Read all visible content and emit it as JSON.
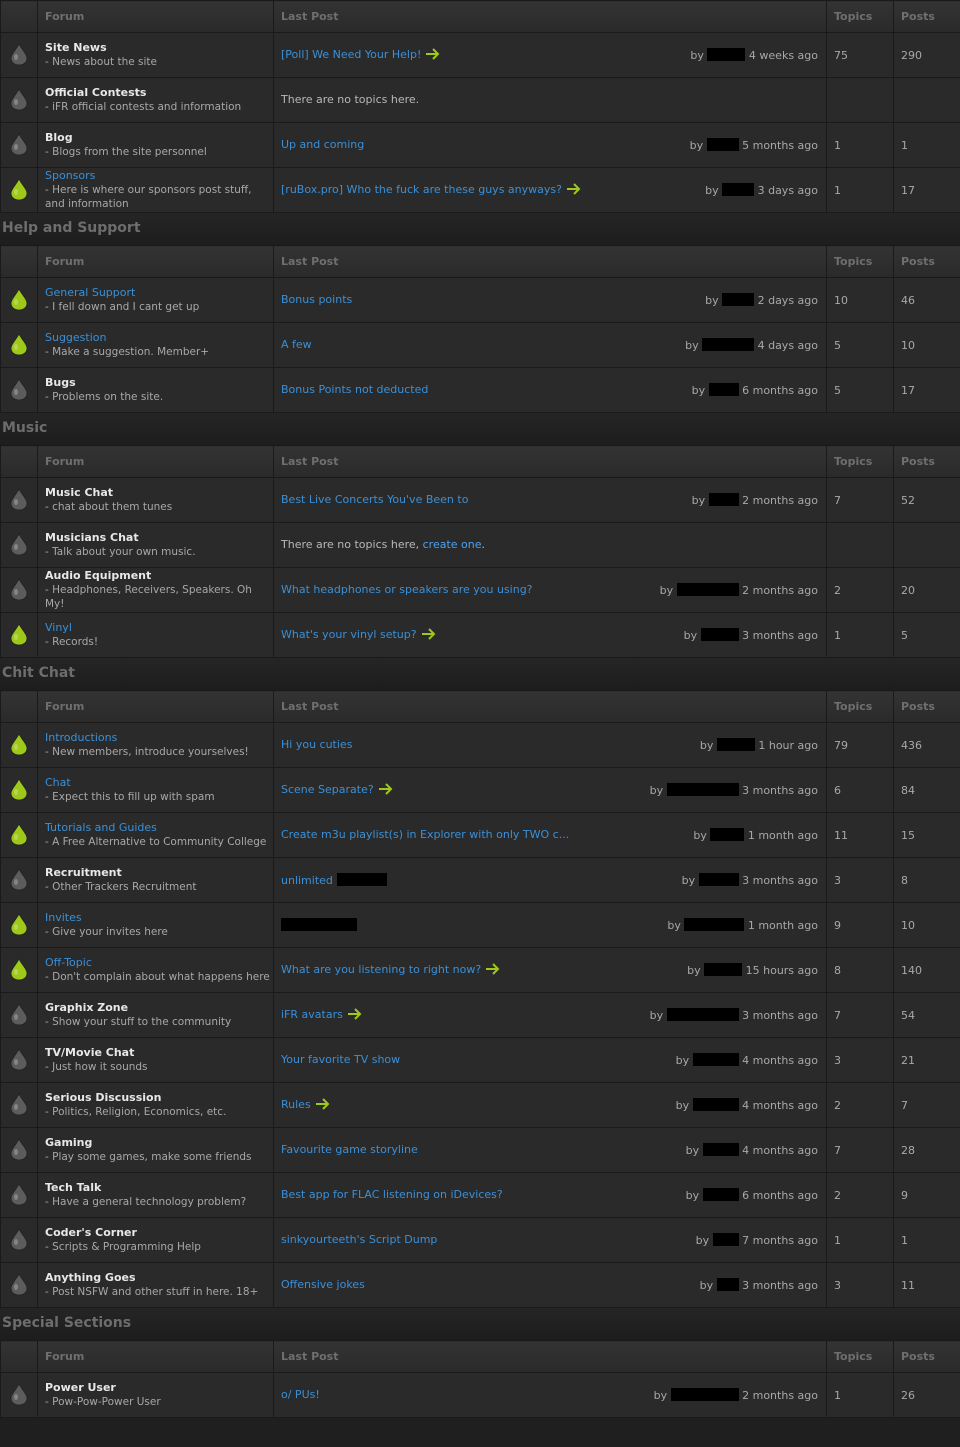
{
  "headers": {
    "forum": "Forum",
    "last_post": "Last Post",
    "topics": "Topics",
    "posts": "Posts"
  },
  "labels": {
    "by": "by",
    "no_topics": "There are no topics here.",
    "no_topics_create_prefix": "There are no topics here, ",
    "create_one": "create one",
    "period": "."
  },
  "colors": {
    "unread_icon": "#9fc91a",
    "read_icon": "#5c5c5c",
    "link": "#3a90d8",
    "arrow": "#9fc91a"
  },
  "categories": [
    {
      "title": "",
      "forums": [
        {
          "name": "Site News",
          "desc": "- News about the site",
          "unread": false,
          "last_title": "[Poll] We Need Your Help!",
          "arrow": true,
          "redact_w": 38,
          "ago": "4 weeks ago",
          "topics": "75",
          "posts": "290"
        },
        {
          "name": "Official Contests",
          "desc": "- iFR official contests and information",
          "unread": false,
          "empty": true
        },
        {
          "name": "Blog",
          "desc": "- Blogs from the site personnel",
          "unread": false,
          "last_title": "Up and coming",
          "arrow": false,
          "redact_w": 32,
          "ago": "5 months ago",
          "topics": "1",
          "posts": "1"
        },
        {
          "name": "Sponsors",
          "desc": "- Here is where our sponsors post stuff, and information",
          "unread": true,
          "last_title": "[ruBox.pro] Who the fuck are these guys anyways?",
          "arrow": true,
          "redact_w": 32,
          "ago": "3 days ago",
          "topics": "1",
          "posts": "17"
        }
      ]
    },
    {
      "title": "Help and Support",
      "forums": [
        {
          "name": "General Support",
          "desc": "- I fell down and I cant get up",
          "unread": true,
          "last_title": "Bonus points",
          "arrow": false,
          "redact_w": 32,
          "ago": "2 days ago",
          "topics": "10",
          "posts": "46"
        },
        {
          "name": "Suggestion",
          "desc": "- Make a suggestion. Member+",
          "unread": true,
          "last_title": "A few",
          "arrow": false,
          "redact_w": 52,
          "ago": "4 days ago",
          "topics": "5",
          "posts": "10"
        },
        {
          "name": "Bugs",
          "desc": "- Problems on the site.",
          "unread": false,
          "last_title": "Bonus Points not deducted",
          "arrow": false,
          "redact_w": 30,
          "ago": "6 months ago",
          "topics": "5",
          "posts": "17"
        }
      ]
    },
    {
      "title": "Music",
      "forums": [
        {
          "name": "Music Chat",
          "desc": "- chat about them tunes",
          "unread": false,
          "last_title": "Best Live Concerts You've Been to",
          "arrow": false,
          "redact_w": 30,
          "ago": "2 months ago",
          "topics": "7",
          "posts": "52"
        },
        {
          "name": "Musicians Chat",
          "desc": "- Talk about your own music.",
          "unread": false,
          "empty_create": true
        },
        {
          "name": "Audio Equipment",
          "desc": "- Headphones, Receivers, Speakers. Oh My!",
          "unread": false,
          "last_title": "What headphones or speakers are you using?",
          "arrow": false,
          "redact_w": 62,
          "ago": "2 months ago",
          "topics": "2",
          "posts": "20"
        },
        {
          "name": "Vinyl",
          "desc": "- Records!",
          "unread": true,
          "last_title": "What's your vinyl setup?",
          "arrow": true,
          "redact_w": 38,
          "ago": "3 months ago",
          "topics": "1",
          "posts": "5"
        }
      ]
    },
    {
      "title": "Chit Chat",
      "forums": [
        {
          "name": "Introductions",
          "desc": "- New members, introduce yourselves!",
          "unread": true,
          "last_title": "Hi you cuties",
          "arrow": false,
          "redact_w": 38,
          "ago": "1 hour ago",
          "topics": "79",
          "posts": "436"
        },
        {
          "name": "Chat",
          "desc": "- Expect this to fill up with spam",
          "unread": true,
          "last_title": "Scene Separate?",
          "arrow": true,
          "redact_w": 72,
          "ago": "3 months ago",
          "topics": "6",
          "posts": "84"
        },
        {
          "name": "Tutorials and Guides",
          "desc": "- A Free Alternative to Community College",
          "unread": true,
          "last_title": "Create m3u playlist(s) in Explorer with only TWO c...",
          "arrow": false,
          "redact_w": 34,
          "ago": "1 month ago",
          "topics": "11",
          "posts": "15"
        },
        {
          "name": "Recruitment",
          "desc": "- Other Trackers Recruitment",
          "unread": false,
          "last_title": "unlimited",
          "arrow": false,
          "title_redact_w": 50,
          "redact_w": 40,
          "ago": "3 months ago",
          "topics": "3",
          "posts": "8"
        },
        {
          "name": "Invites",
          "desc": "- Give your invites here",
          "unread": true,
          "last_title": "",
          "arrow": false,
          "title_redact_w": 76,
          "redact_w": 60,
          "ago": "1 month ago",
          "topics": "9",
          "posts": "10"
        },
        {
          "name": "Off-Topic",
          "desc": "- Don't complain about what happens here",
          "unread": true,
          "last_title": "What are you listening to right now?",
          "arrow": true,
          "redact_w": 38,
          "ago": "15 hours ago",
          "topics": "8",
          "posts": "140"
        },
        {
          "name": "Graphix Zone",
          "desc": "- Show your stuff to the community",
          "unread": false,
          "last_title": "iFR avatars",
          "arrow": true,
          "redact_w": 72,
          "ago": "3 months ago",
          "topics": "7",
          "posts": "54"
        },
        {
          "name": "TV/Movie Chat",
          "desc": "- Just how it sounds",
          "unread": false,
          "last_title": "Your favorite TV show",
          "arrow": false,
          "redact_w": 46,
          "ago": "4 months ago",
          "topics": "3",
          "posts": "21"
        },
        {
          "name": "Serious Discussion",
          "desc": "- Politics, Religion, Economics, etc.",
          "unread": false,
          "last_title": "Rules",
          "arrow": true,
          "redact_w": 46,
          "ago": "4 months ago",
          "topics": "2",
          "posts": "7"
        },
        {
          "name": "Gaming",
          "desc": "- Play some games, make some friends",
          "unread": false,
          "last_title": "Favourite game storyline",
          "arrow": false,
          "redact_w": 36,
          "ago": "4 months ago",
          "topics": "7",
          "posts": "28"
        },
        {
          "name": "Tech Talk",
          "desc": "- Have a general technology problem?",
          "unread": false,
          "last_title": "Best app for FLAC listening on iDevices?",
          "arrow": false,
          "redact_w": 36,
          "ago": "6 months ago",
          "topics": "2",
          "posts": "9"
        },
        {
          "name": "Coder's Corner",
          "desc": "- Scripts & Programming Help",
          "unread": false,
          "last_title": "sinkyourteeth's Script Dump",
          "arrow": false,
          "redact_w": 26,
          "ago": "7 months ago",
          "topics": "1",
          "posts": "1"
        },
        {
          "name": "Anything Goes",
          "desc": "- Post NSFW and other stuff in here. 18+",
          "unread": false,
          "last_title": "Offensive jokes",
          "arrow": false,
          "redact_w": 22,
          "ago": "3 months ago",
          "topics": "3",
          "posts": "11"
        }
      ]
    },
    {
      "title": "Special Sections",
      "forums": [
        {
          "name": "Power User",
          "desc": "- Pow-Pow-Power User",
          "unread": false,
          "last_title": "o/ PUs!",
          "arrow": false,
          "redact_w": 68,
          "ago": "2 months ago",
          "topics": "1",
          "posts": "26"
        }
      ]
    }
  ]
}
